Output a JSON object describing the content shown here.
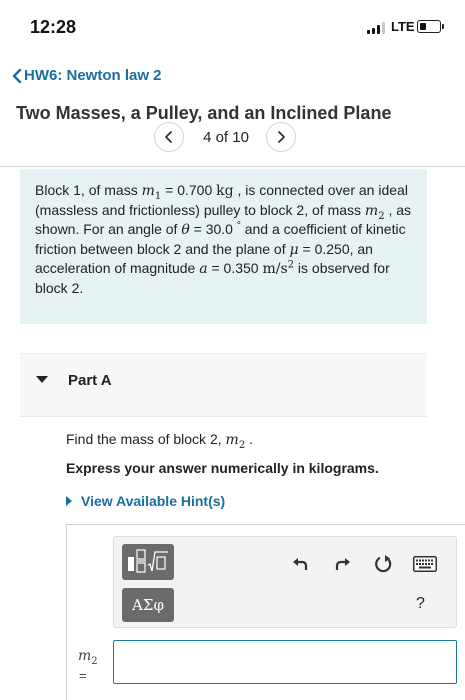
{
  "status_bar": {
    "time": "12:28",
    "network": "LTE",
    "signal_bars_filled": 3,
    "signal_bars_total": 4
  },
  "nav": {
    "back_label": "HW6: Newton law 2",
    "title": "Two Masses, a Pulley, and an Inclined Plane",
    "pager": "4 of 10",
    "prev_icon": "chevron-left-icon",
    "next_icon": "chevron-right-icon"
  },
  "problem": {
    "t1": "Block 1, of mass ",
    "m1": "m",
    "m1_sub": "1",
    "t2": " = 0.700 ",
    "unit_kg": "kg",
    "t3": " , is connected over an ideal (massless and frictionless) pulley to block 2, of mass ",
    "m2": "m",
    "m2_sub": "2",
    "t4": " , as shown. For an angle of ",
    "theta": "θ",
    "t5": " = 30.0 ",
    "deg": "°",
    "t6": "  and a coefficient of kinetic friction between block 2 and the plane of ",
    "mu": "μ",
    "t7": " = 0.250, an acceleration of magnitude ",
    "a": "a",
    "t8": " = 0.350 ",
    "unit_m": "m/s",
    "unit_sup": "2",
    "t9": "  is observed for block 2."
  },
  "part": {
    "label": "Part A",
    "find_text": "Find the mass of block 2, ",
    "find_var": "m",
    "find_sub": "2",
    "find_end": " .",
    "express": "Express your answer numerically in kilograms.",
    "hint": "View Available Hint(s)"
  },
  "answer": {
    "greek_label": "ΑΣφ",
    "help_label": "?",
    "var": "m",
    "var_sub": "2",
    "eq": "=",
    "value": "",
    "icons": [
      "template-icon",
      "undo-icon",
      "redo-icon",
      "reset-icon",
      "keyboard-icon"
    ]
  },
  "colors": {
    "link": "#1a6ea0",
    "problem_bg": "#e6f2f4",
    "input_border": "#1a7d9a",
    "tool_dark": "#6b6b6b"
  }
}
